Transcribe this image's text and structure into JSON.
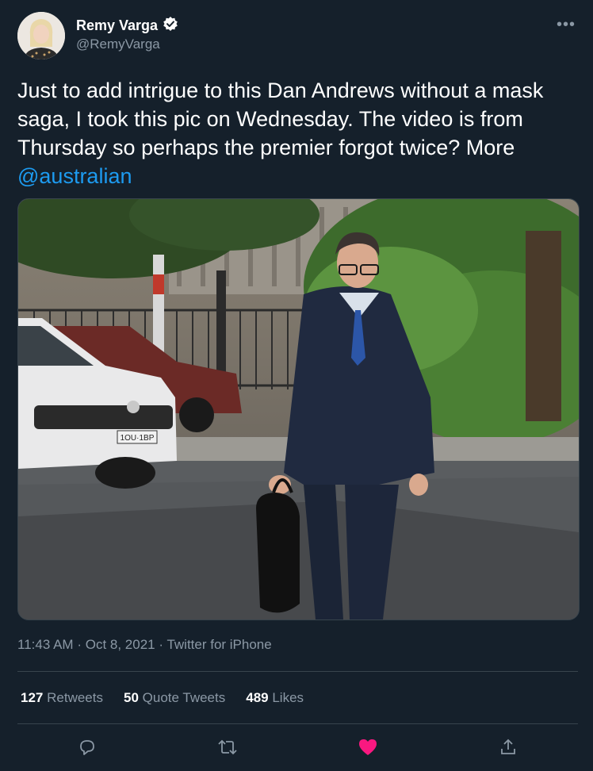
{
  "author": {
    "name": "Remy Varga",
    "handle": "@RemyVarga",
    "verified": true
  },
  "tweet": {
    "text": "Just to add intrigue to this Dan Andrews without a mask saga, I took this pic on Wednesday. The video is from Thursday so perhaps the premier forgot twice? More ",
    "mention": "@australian"
  },
  "photo": {
    "plate": "1OU·1BP"
  },
  "meta": {
    "time": "11:43 AM",
    "date": "Oct 8, 2021",
    "source": "Twitter for iPhone",
    "separator": "·"
  },
  "stats": {
    "retweets_count": "127",
    "retweets_label": "Retweets",
    "quotes_count": "50",
    "quotes_label": "Quote Tweets",
    "likes_count": "489",
    "likes_label": "Likes"
  },
  "icons": {
    "reply": "reply-icon",
    "retweet": "retweet-icon",
    "like": "heart-icon",
    "share": "share-icon",
    "more": "more-icon"
  },
  "colors": {
    "background": "#15202b",
    "accent": "#1d9bf0",
    "like": "#f91880",
    "muted": "#8b98a5"
  }
}
